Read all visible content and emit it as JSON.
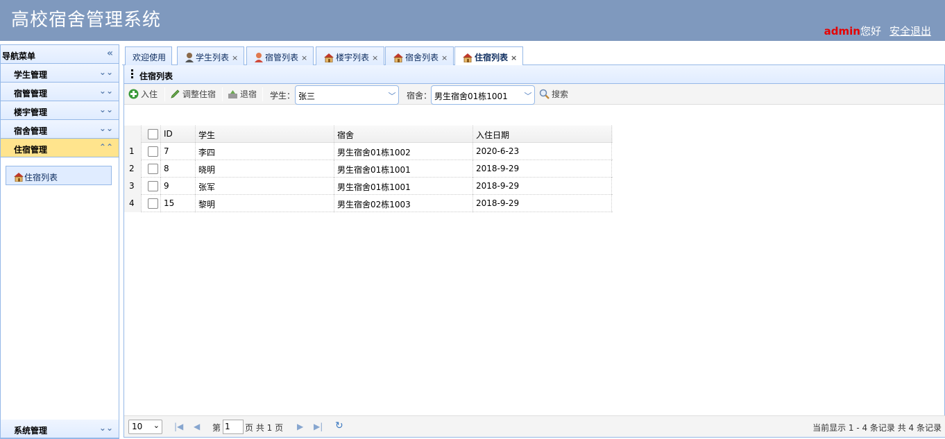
{
  "header": {
    "title": "高校宿舍管理系统",
    "user": "admin",
    "greeting": "您好",
    "logout": "安全退出"
  },
  "sidebar": {
    "title": "导航菜单",
    "collapse_icon": "double-chevron-left-icon",
    "panels": [
      {
        "label": "学生管理"
      },
      {
        "label": "宿管管理"
      },
      {
        "label": "楼宇管理"
      },
      {
        "label": "宿舍管理"
      },
      {
        "label": "住宿管理"
      }
    ],
    "active_sub": "住宿列表",
    "bottom_panel": "系统管理"
  },
  "tabs": [
    {
      "label": "欢迎使用",
      "icon": "",
      "closable": false
    },
    {
      "label": "学生列表",
      "icon": "person-icon",
      "closable": true
    },
    {
      "label": "宿管列表",
      "icon": "person-icon",
      "closable": true
    },
    {
      "label": "楼宇列表",
      "icon": "house-icon",
      "closable": true
    },
    {
      "label": "宿舍列表",
      "icon": "house-icon",
      "closable": true
    },
    {
      "label": "住宿列表",
      "icon": "house-icon",
      "closable": true
    }
  ],
  "panel_title": "住宿列表",
  "toolbar": {
    "checkin": "入住",
    "adjust": "调整住宿",
    "checkout": "退宿",
    "student_label": "学生：",
    "student_value": "张三",
    "dorm_label": "宿舍：",
    "dorm_value": "男生宿舍01栋1001",
    "search": "搜索"
  },
  "grid": {
    "columns": [
      "ID",
      "学生",
      "宿舍",
      "入住日期"
    ],
    "rows": [
      {
        "num": "1",
        "id": "7",
        "student": "李四",
        "dorm": "男生宿舍01栋1002",
        "date": "2020-6-23"
      },
      {
        "num": "2",
        "id": "8",
        "student": "晓明",
        "dorm": "男生宿舍01栋1001",
        "date": "2018-9-29"
      },
      {
        "num": "3",
        "id": "9",
        "student": "张军",
        "dorm": "男生宿舍01栋1001",
        "date": "2018-9-29"
      },
      {
        "num": "4",
        "id": "15",
        "student": "黎明",
        "dorm": "男生宿舍02栋1003",
        "date": "2018-9-29"
      }
    ]
  },
  "pager": {
    "page_size": "10",
    "page_prefix": "第",
    "page_value": "1",
    "page_suffix": "页 共 1 页",
    "summary": "当前显示 1 - 4 条记录 共 4 条记录"
  },
  "colors": {
    "header_bg": "#7f99be",
    "border": "#95b8e7",
    "active_panel": "#ffe48d",
    "user_name": "#e60000"
  }
}
